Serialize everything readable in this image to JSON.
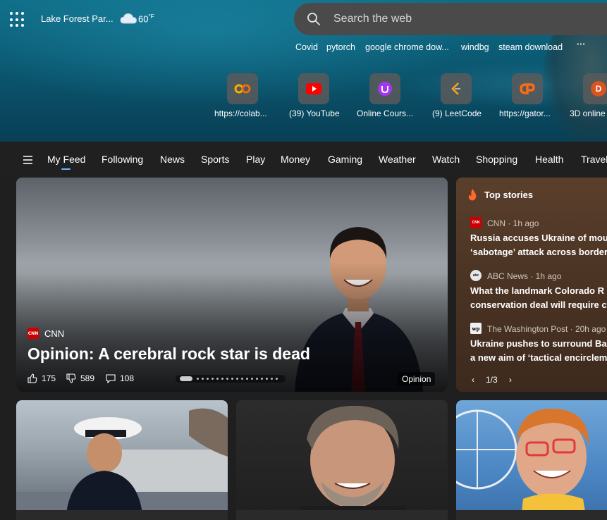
{
  "header": {
    "location": "Lake Forest Par...",
    "temperature": "60",
    "temp_unit": "°F",
    "weather_icon": "cloud-icon"
  },
  "search": {
    "placeholder": "Search the web"
  },
  "trending": [
    "Covid",
    "pytorch",
    "google chrome dow...",
    "windbg",
    "steam download",
    "···"
  ],
  "quicklinks": [
    {
      "label": "https://colab...",
      "icon": "colab-icon",
      "color": "#f9ab00"
    },
    {
      "label": "(39) YouTube",
      "icon": "youtube-icon",
      "color": "#ff0000"
    },
    {
      "label": "Online Cours...",
      "icon": "udemy-icon",
      "color": "#a435f0"
    },
    {
      "label": "(9) LeetCode",
      "icon": "leetcode-icon",
      "color": "#ffa116"
    },
    {
      "label": "https://gator...",
      "icon": "gator-icon",
      "color": "#ff6a13"
    },
    {
      "label": "3D online",
      "icon": "d-icon",
      "color": "#d9541e",
      "letter": "D"
    }
  ],
  "nav": {
    "items": [
      "My Feed",
      "Following",
      "News",
      "Sports",
      "Play",
      "Money",
      "Gaming",
      "Weather",
      "Watch",
      "Shopping",
      "Health",
      "Travel"
    ],
    "active": "My Feed"
  },
  "main_card": {
    "source": "CNN",
    "logo_text": "CNN",
    "title": "Opinion: A cerebral rock star is dead",
    "likes": "175",
    "dislikes": "589",
    "comments": "108",
    "tag": "Opinion"
  },
  "top_stories": {
    "header": "Top stories",
    "items": [
      {
        "source": "CNN · 1h ago",
        "logo": "CNN",
        "title_line1": "Russia accuses Ukraine of mou",
        "title_line2": "‘sabotage’ attack across border"
      },
      {
        "source": "ABC News · 1h ago",
        "logo": "abc",
        "title_line1": "What the landmark Colorado R",
        "title_line2": "conservation deal will require c"
      },
      {
        "source": "The Washington Post · 20h ago",
        "logo": "wp",
        "title_line1": "Ukraine pushes to surround Ba",
        "title_line2": "a new aim of ‘tactical encirclem"
      }
    ],
    "pagination": "1/3"
  },
  "colors": {
    "accent": "#6bb6ff",
    "cnn_red": "#cc0000",
    "nav_bg": "#202020",
    "search_bg": "#4a4a4a"
  }
}
